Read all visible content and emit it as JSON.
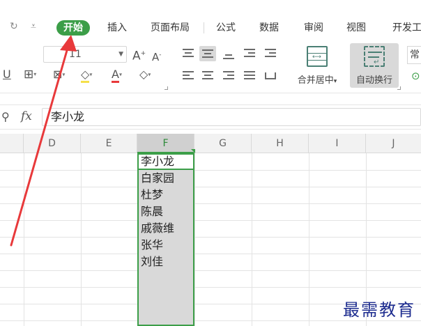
{
  "tabs": [
    {
      "label": "开始",
      "active": true
    },
    {
      "label": "插入",
      "active": false
    },
    {
      "label": "页面布局",
      "active": false
    },
    {
      "label": "公式",
      "active": false
    },
    {
      "label": "数据",
      "active": false
    },
    {
      "label": "审阅",
      "active": false
    },
    {
      "label": "视图",
      "active": false
    },
    {
      "label": "开发工",
      "active": false
    }
  ],
  "ribbon": {
    "font_size_value": "11",
    "grow_font": "A",
    "shrink_font": "A",
    "underline": "U",
    "font_color_letter": "A",
    "merge_center_label": "合并居中",
    "wrap_text_label": "自动换行",
    "number_format_partial": "常"
  },
  "formula_bar": {
    "fx_label": "fx",
    "value": "李小龙"
  },
  "columns": [
    "D",
    "E",
    "F",
    "G",
    "H",
    "I",
    "J"
  ],
  "selected_column": "F",
  "cells_f": [
    "李小龙",
    "白家园",
    "杜梦",
    "陈晨",
    "戚薇维",
    "张华",
    "刘佳"
  ],
  "watermark": "最需教育",
  "colors": {
    "accent_green": "#3c9e48",
    "arrow_red": "#e8393b",
    "watermark_blue": "#1d2c8f"
  }
}
